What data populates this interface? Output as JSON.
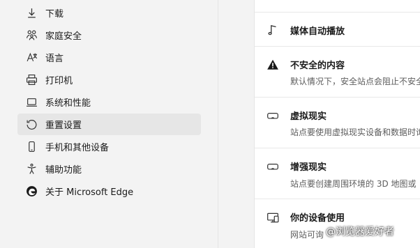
{
  "sidebar": {
    "items": [
      {
        "label": "下载",
        "icon": "download-icon"
      },
      {
        "label": "家庭安全",
        "icon": "family-icon"
      },
      {
        "label": "语言",
        "icon": "language-icon"
      },
      {
        "label": "打印机",
        "icon": "printer-icon"
      },
      {
        "label": "系统和性能",
        "icon": "laptop-icon"
      },
      {
        "label": "重置设置",
        "icon": "reset-icon",
        "active": true
      },
      {
        "label": "手机和其他设备",
        "icon": "phone-icon"
      },
      {
        "label": "辅助功能",
        "icon": "accessibility-icon"
      },
      {
        "label": "关于 Microsoft Edge",
        "icon": "edge-logo-icon"
      }
    ]
  },
  "permissions": {
    "items": [
      {
        "title": "媒体自动播放",
        "desc": "",
        "icon": "music-note-icon"
      },
      {
        "title": "不安全的内容",
        "desc": "默认情况下，安全站点会阻止不安全",
        "icon": "warning-icon"
      },
      {
        "title": "虚拟现实",
        "desc": "站点要使用虚拟现实设备和数据时询",
        "icon": "vr-headset-icon"
      },
      {
        "title": "增强现实",
        "desc": "站点要创建周围环境的 3D 地图或",
        "icon": "ar-headset-icon"
      },
      {
        "title": "你的设备使用",
        "desc": "网站可询",
        "icon": "device-usage-icon"
      }
    ]
  },
  "watermark": "@浏览器爱好者"
}
